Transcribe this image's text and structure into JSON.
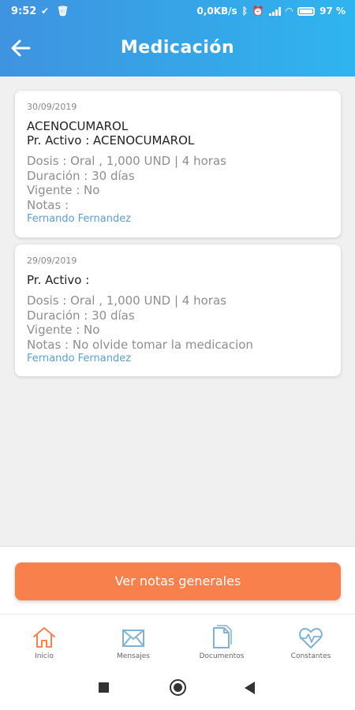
{
  "status_bar": {
    "time": "9:52",
    "speed": "0,0KB/s",
    "battery": "97 %"
  },
  "header": {
    "title": "Medicación"
  },
  "medications": [
    {
      "date": "30/09/2019",
      "name": "ACENOCUMAROL",
      "active": "Pr. Activo : ACENOCUMAROL",
      "dosis": "Dosis : Oral , 1,000 UND | 4 horas",
      "duracion": "Duración : 30 días",
      "vigente": "Vigente : No",
      "notas": "Notas :",
      "doctor": "Fernando Fernandez"
    },
    {
      "date": "29/09/2019",
      "active": "Pr. Activo :",
      "dosis": "Dosis : Oral , 1,000 UND | 4 horas",
      "duracion": "Duración : 30 días",
      "vigente": "Vigente : No",
      "notas": "Notas : No olvide tomar la medicacion",
      "doctor": "Fernando Fernandez"
    }
  ],
  "actions": {
    "notes_button": "Ver notas generales"
  },
  "tabs": [
    {
      "label": "Inicio",
      "icon": "home-icon"
    },
    {
      "label": "Mensajes",
      "icon": "envelope-icon"
    },
    {
      "label": "Documentos",
      "icon": "document-icon"
    },
    {
      "label": "Constantes",
      "icon": "heartbeat-icon"
    }
  ],
  "colors": {
    "header_start": "#3f93e0",
    "header_end": "#2fb4ef",
    "accent_orange": "#f7804d",
    "doctor_link": "#5aa1cf",
    "icon_blue": "#7fb3d5"
  }
}
